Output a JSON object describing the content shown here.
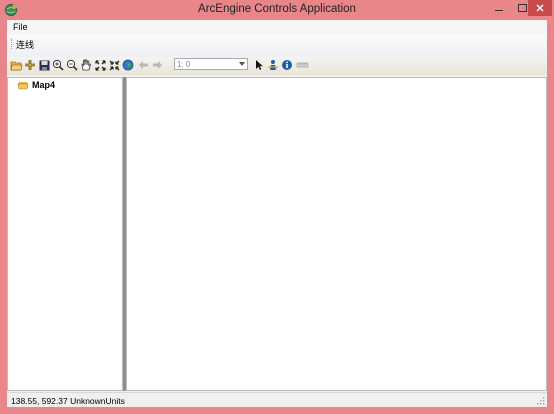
{
  "window": {
    "title": "ArcEngine Controls Application",
    "icon": "globe-app-icon",
    "frame_color": "#e8868a",
    "close_color": "#c94a4d"
  },
  "menu": {
    "file_label": "File"
  },
  "strip": {
    "item_label": "连线"
  },
  "toolbar": {
    "icons": [
      "open-folder-icon",
      "add-data-icon",
      "save-icon",
      "zoom-in-icon",
      "zoom-out-icon",
      "pan-hand-icon",
      "fixed-zoom-in-icon",
      "fixed-zoom-out-icon",
      "full-extent-globe-icon",
      "back-arrow-icon",
      "forward-arrow-icon",
      "select-arrow-icon",
      "identify-person-icon",
      "info-icon",
      "measure-icon"
    ],
    "scale_value": "1: 0"
  },
  "toc": {
    "map_name": "Map4"
  },
  "status": {
    "text": "138.55, 592.37  UnknownUnits"
  }
}
